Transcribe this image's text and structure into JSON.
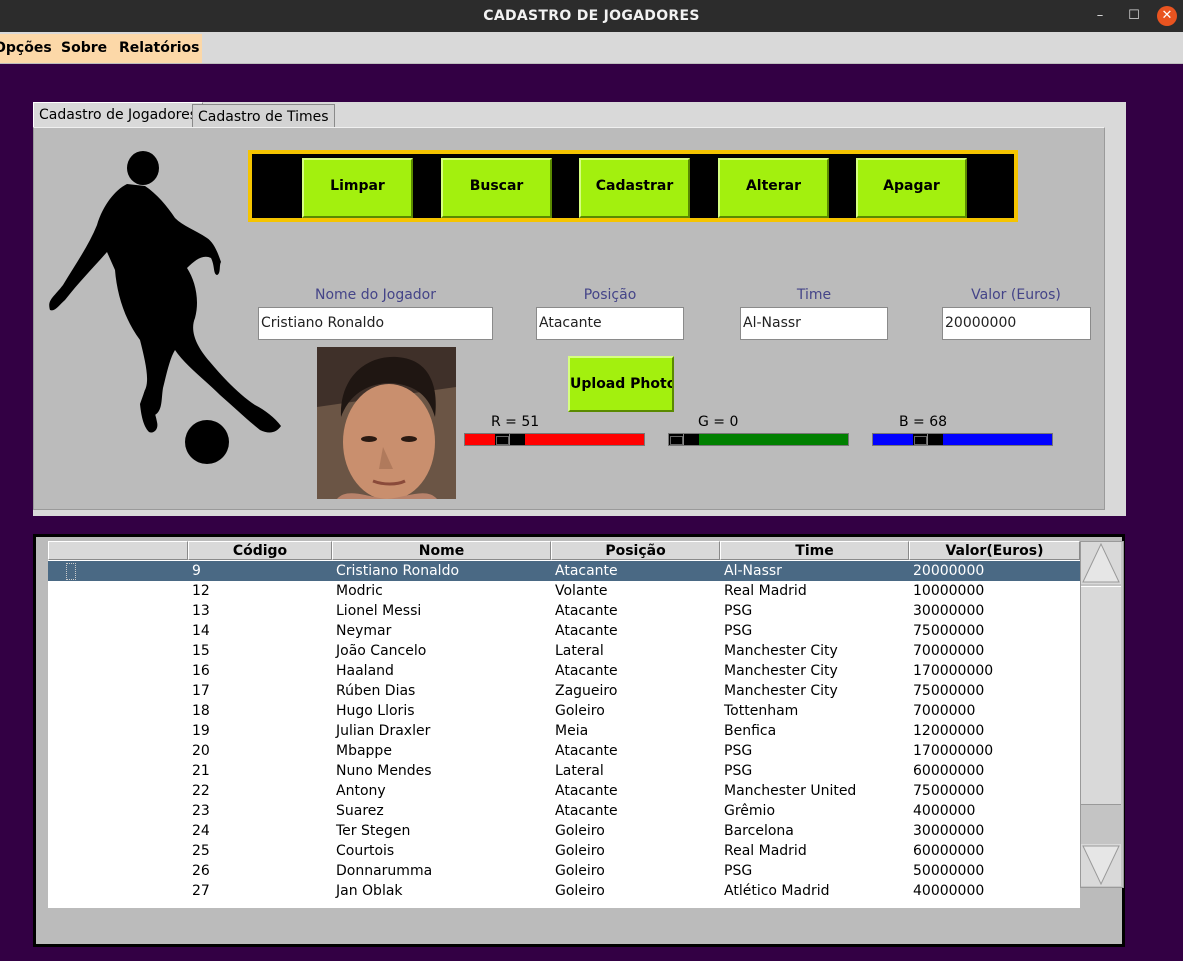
{
  "window": {
    "title": "CADASTRO DE JOGADORES",
    "minimize": "–",
    "maximize": "☐",
    "close": "✕"
  },
  "menu": [
    {
      "label": "Opções"
    },
    {
      "label": "Sobre"
    },
    {
      "label": "Relatórios"
    }
  ],
  "tabs": [
    {
      "label": "Cadastro de Jogadores",
      "active": true
    },
    {
      "label": "Cadastro de Times",
      "active": false
    }
  ],
  "actions": {
    "clear": "Limpar",
    "search": "Buscar",
    "register": "Cadastrar",
    "update": "Alterar",
    "delete": "Apagar"
  },
  "form": {
    "name_label": "Nome do Jogador",
    "name_value": "Cristiano Ronaldo",
    "position_label": "Posição",
    "position_value": "Atacante",
    "team_label": "Time",
    "team_value": "Al-Nassr",
    "value_label": "Valor (Euros)",
    "value_value": "20000000"
  },
  "upload_label": "Upload Photo",
  "sliders": {
    "r_label": "R = 51",
    "r_value": 51,
    "g_label": "G = 0",
    "g_value": 0,
    "b_label": "B = 68",
    "b_value": 68,
    "r_color": "#ff0000",
    "g_color": "#008000",
    "b_color": "#0000ff"
  },
  "colors": {
    "background": "#330044",
    "button": "#a3f00e",
    "button_strip_border": "#f5c400",
    "selected_row": "#4a6984"
  },
  "table": {
    "headers": [
      "",
      "Código",
      "Nome",
      "Posição",
      "Time",
      "Valor(Euros)"
    ],
    "selected_index": 0,
    "rows": [
      [
        "9",
        "Cristiano Ronaldo",
        "Atacante",
        "Al-Nassr",
        "20000000"
      ],
      [
        "12",
        "Modric",
        "Volante",
        "Real Madrid",
        "10000000"
      ],
      [
        "13",
        "Lionel Messi",
        "Atacante",
        "PSG",
        "30000000"
      ],
      [
        "14",
        "Neymar",
        "Atacante",
        "PSG",
        "75000000"
      ],
      [
        "15",
        "João Cancelo",
        "Lateral",
        "Manchester City",
        "70000000"
      ],
      [
        "16",
        "Haaland",
        "Atacante",
        "Manchester City",
        "170000000"
      ],
      [
        "17",
        "Rúben Dias",
        "Zagueiro",
        "Manchester City",
        "75000000"
      ],
      [
        "18",
        "Hugo Lloris",
        "Goleiro",
        "Tottenham",
        "7000000"
      ],
      [
        "19",
        "Julian Draxler",
        "Meia",
        "Benfica",
        "12000000"
      ],
      [
        "20",
        "Mbappe",
        "Atacante",
        "PSG",
        "170000000"
      ],
      [
        "21",
        "Nuno Mendes",
        "Lateral",
        "PSG",
        "60000000"
      ],
      [
        "22",
        "Antony",
        "Atacante",
        "Manchester United",
        "75000000"
      ],
      [
        "23",
        "Suarez",
        "Atacante",
        "Grêmio",
        "4000000"
      ],
      [
        "24",
        "Ter Stegen",
        "Goleiro",
        "Barcelona",
        "30000000"
      ],
      [
        "25",
        "Courtois",
        "Goleiro",
        "Real Madrid",
        "60000000"
      ],
      [
        "26",
        "Donnarumma",
        "Goleiro",
        "PSG",
        "50000000"
      ],
      [
        "27",
        "Jan Oblak",
        "Goleiro",
        "Atlético Madrid",
        "40000000"
      ]
    ]
  }
}
